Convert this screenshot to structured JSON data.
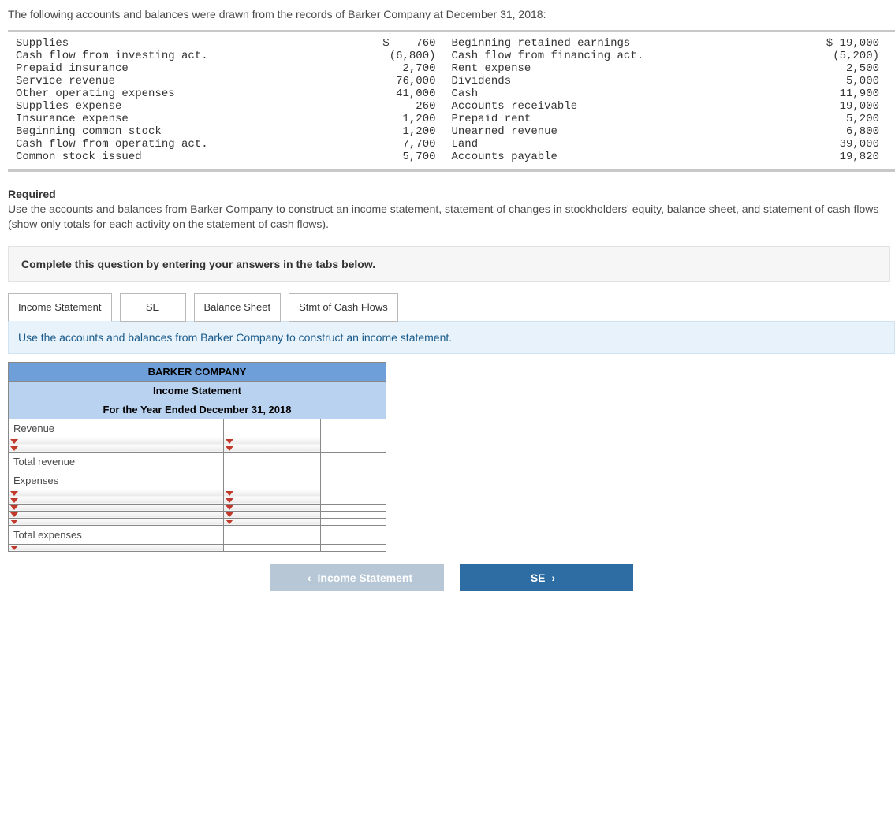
{
  "intro": "The following accounts and balances were drawn from the records of Barker Company at December 31, 2018:",
  "accounts_left": [
    {
      "label": "Supplies",
      "value": "$    760"
    },
    {
      "label": "Cash flow from investing act.",
      "value": "(6,800)"
    },
    {
      "label": "Prepaid insurance",
      "value": "2,700"
    },
    {
      "label": "Service revenue",
      "value": "76,000"
    },
    {
      "label": "Other operating expenses",
      "value": "41,000"
    },
    {
      "label": "Supplies expense",
      "value": "260"
    },
    {
      "label": "Insurance expense",
      "value": "1,200"
    },
    {
      "label": "Beginning common stock",
      "value": "1,200"
    },
    {
      "label": "Cash flow from operating act.",
      "value": "7,700"
    },
    {
      "label": "Common stock issued",
      "value": "5,700"
    }
  ],
  "accounts_right": [
    {
      "label": "Beginning retained earnings",
      "value": "$ 19,000"
    },
    {
      "label": "Cash flow from financing act.",
      "value": "(5,200)"
    },
    {
      "label": "Rent expense",
      "value": "2,500"
    },
    {
      "label": "Dividends",
      "value": "5,000"
    },
    {
      "label": "Cash",
      "value": "11,900"
    },
    {
      "label": "Accounts receivable",
      "value": "19,000"
    },
    {
      "label": "Prepaid rent",
      "value": "5,200"
    },
    {
      "label": "Unearned revenue",
      "value": "6,800"
    },
    {
      "label": "Land",
      "value": "39,000"
    },
    {
      "label": "Accounts payable",
      "value": "19,820"
    }
  ],
  "required_heading": "Required",
  "required_text": "Use the accounts and balances from Barker Company to construct an income statement, statement of changes in stockholders' equity, balance sheet, and statement of cash flows (show only totals for each activity on the statement of cash flows).",
  "answer_panel": "Complete this question by entering your answers in the tabs below.",
  "tabs": {
    "income": "Income Statement",
    "se": "SE",
    "balance": "Balance Sheet",
    "cash": "Stmt of Cash Flows"
  },
  "tab_instruction": "Use the accounts and balances from Barker Company to construct an income statement.",
  "worksheet": {
    "company": "BARKER COMPANY",
    "title": "Income Statement",
    "period": "For the Year Ended December 31, 2018",
    "rows": {
      "revenue": "Revenue",
      "total_revenue": "Total revenue",
      "expenses": "Expenses",
      "total_expenses": "Total expenses"
    }
  },
  "nav": {
    "prev": "Income Statement",
    "next": "SE"
  }
}
